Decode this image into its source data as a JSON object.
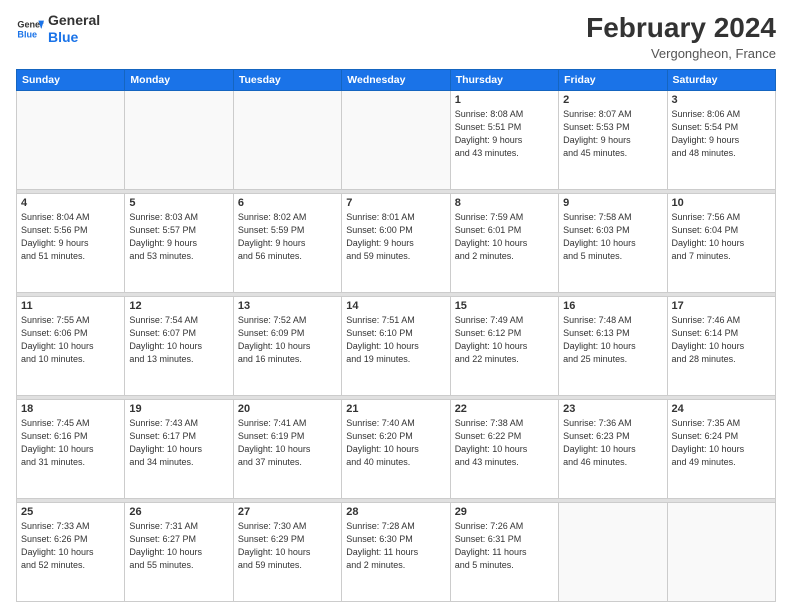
{
  "header": {
    "logo_general": "General",
    "logo_blue": "Blue",
    "main_title": "February 2024",
    "subtitle": "Vergongheon, France"
  },
  "calendar": {
    "days_of_week": [
      "Sunday",
      "Monday",
      "Tuesday",
      "Wednesday",
      "Thursday",
      "Friday",
      "Saturday"
    ],
    "weeks": [
      [
        {
          "day": "",
          "info": ""
        },
        {
          "day": "",
          "info": ""
        },
        {
          "day": "",
          "info": ""
        },
        {
          "day": "",
          "info": ""
        },
        {
          "day": "1",
          "info": "Sunrise: 8:08 AM\nSunset: 5:51 PM\nDaylight: 9 hours\nand 43 minutes."
        },
        {
          "day": "2",
          "info": "Sunrise: 8:07 AM\nSunset: 5:53 PM\nDaylight: 9 hours\nand 45 minutes."
        },
        {
          "day": "3",
          "info": "Sunrise: 8:06 AM\nSunset: 5:54 PM\nDaylight: 9 hours\nand 48 minutes."
        }
      ],
      [
        {
          "day": "4",
          "info": "Sunrise: 8:04 AM\nSunset: 5:56 PM\nDaylight: 9 hours\nand 51 minutes."
        },
        {
          "day": "5",
          "info": "Sunrise: 8:03 AM\nSunset: 5:57 PM\nDaylight: 9 hours\nand 53 minutes."
        },
        {
          "day": "6",
          "info": "Sunrise: 8:02 AM\nSunset: 5:59 PM\nDaylight: 9 hours\nand 56 minutes."
        },
        {
          "day": "7",
          "info": "Sunrise: 8:01 AM\nSunset: 6:00 PM\nDaylight: 9 hours\nand 59 minutes."
        },
        {
          "day": "8",
          "info": "Sunrise: 7:59 AM\nSunset: 6:01 PM\nDaylight: 10 hours\nand 2 minutes."
        },
        {
          "day": "9",
          "info": "Sunrise: 7:58 AM\nSunset: 6:03 PM\nDaylight: 10 hours\nand 5 minutes."
        },
        {
          "day": "10",
          "info": "Sunrise: 7:56 AM\nSunset: 6:04 PM\nDaylight: 10 hours\nand 7 minutes."
        }
      ],
      [
        {
          "day": "11",
          "info": "Sunrise: 7:55 AM\nSunset: 6:06 PM\nDaylight: 10 hours\nand 10 minutes."
        },
        {
          "day": "12",
          "info": "Sunrise: 7:54 AM\nSunset: 6:07 PM\nDaylight: 10 hours\nand 13 minutes."
        },
        {
          "day": "13",
          "info": "Sunrise: 7:52 AM\nSunset: 6:09 PM\nDaylight: 10 hours\nand 16 minutes."
        },
        {
          "day": "14",
          "info": "Sunrise: 7:51 AM\nSunset: 6:10 PM\nDaylight: 10 hours\nand 19 minutes."
        },
        {
          "day": "15",
          "info": "Sunrise: 7:49 AM\nSunset: 6:12 PM\nDaylight: 10 hours\nand 22 minutes."
        },
        {
          "day": "16",
          "info": "Sunrise: 7:48 AM\nSunset: 6:13 PM\nDaylight: 10 hours\nand 25 minutes."
        },
        {
          "day": "17",
          "info": "Sunrise: 7:46 AM\nSunset: 6:14 PM\nDaylight: 10 hours\nand 28 minutes."
        }
      ],
      [
        {
          "day": "18",
          "info": "Sunrise: 7:45 AM\nSunset: 6:16 PM\nDaylight: 10 hours\nand 31 minutes."
        },
        {
          "day": "19",
          "info": "Sunrise: 7:43 AM\nSunset: 6:17 PM\nDaylight: 10 hours\nand 34 minutes."
        },
        {
          "day": "20",
          "info": "Sunrise: 7:41 AM\nSunset: 6:19 PM\nDaylight: 10 hours\nand 37 minutes."
        },
        {
          "day": "21",
          "info": "Sunrise: 7:40 AM\nSunset: 6:20 PM\nDaylight: 10 hours\nand 40 minutes."
        },
        {
          "day": "22",
          "info": "Sunrise: 7:38 AM\nSunset: 6:22 PM\nDaylight: 10 hours\nand 43 minutes."
        },
        {
          "day": "23",
          "info": "Sunrise: 7:36 AM\nSunset: 6:23 PM\nDaylight: 10 hours\nand 46 minutes."
        },
        {
          "day": "24",
          "info": "Sunrise: 7:35 AM\nSunset: 6:24 PM\nDaylight: 10 hours\nand 49 minutes."
        }
      ],
      [
        {
          "day": "25",
          "info": "Sunrise: 7:33 AM\nSunset: 6:26 PM\nDaylight: 10 hours\nand 52 minutes."
        },
        {
          "day": "26",
          "info": "Sunrise: 7:31 AM\nSunset: 6:27 PM\nDaylight: 10 hours\nand 55 minutes."
        },
        {
          "day": "27",
          "info": "Sunrise: 7:30 AM\nSunset: 6:29 PM\nDaylight: 10 hours\nand 59 minutes."
        },
        {
          "day": "28",
          "info": "Sunrise: 7:28 AM\nSunset: 6:30 PM\nDaylight: 11 hours\nand 2 minutes."
        },
        {
          "day": "29",
          "info": "Sunrise: 7:26 AM\nSunset: 6:31 PM\nDaylight: 11 hours\nand 5 minutes."
        },
        {
          "day": "",
          "info": ""
        },
        {
          "day": "",
          "info": ""
        }
      ]
    ]
  }
}
